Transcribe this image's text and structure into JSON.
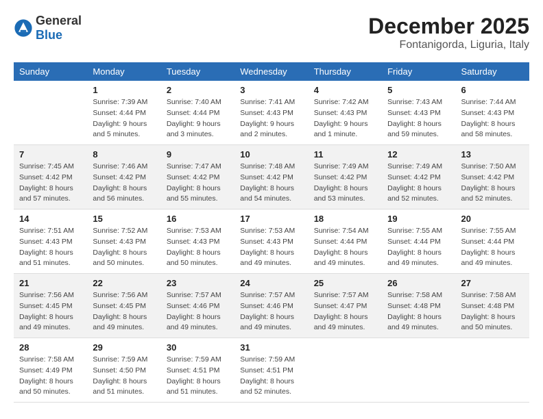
{
  "logo": {
    "general": "General",
    "blue": "Blue"
  },
  "title": "December 2025",
  "subtitle": "Fontanigorda, Liguria, Italy",
  "weekdays": [
    "Sunday",
    "Monday",
    "Tuesday",
    "Wednesday",
    "Thursday",
    "Friday",
    "Saturday"
  ],
  "weeks": [
    [
      {
        "day": "",
        "sunrise": "",
        "sunset": "",
        "daylight": ""
      },
      {
        "day": "1",
        "sunrise": "Sunrise: 7:39 AM",
        "sunset": "Sunset: 4:44 PM",
        "daylight": "Daylight: 9 hours and 5 minutes."
      },
      {
        "day": "2",
        "sunrise": "Sunrise: 7:40 AM",
        "sunset": "Sunset: 4:44 PM",
        "daylight": "Daylight: 9 hours and 3 minutes."
      },
      {
        "day": "3",
        "sunrise": "Sunrise: 7:41 AM",
        "sunset": "Sunset: 4:43 PM",
        "daylight": "Daylight: 9 hours and 2 minutes."
      },
      {
        "day": "4",
        "sunrise": "Sunrise: 7:42 AM",
        "sunset": "Sunset: 4:43 PM",
        "daylight": "Daylight: 9 hours and 1 minute."
      },
      {
        "day": "5",
        "sunrise": "Sunrise: 7:43 AM",
        "sunset": "Sunset: 4:43 PM",
        "daylight": "Daylight: 8 hours and 59 minutes."
      },
      {
        "day": "6",
        "sunrise": "Sunrise: 7:44 AM",
        "sunset": "Sunset: 4:43 PM",
        "daylight": "Daylight: 8 hours and 58 minutes."
      }
    ],
    [
      {
        "day": "7",
        "sunrise": "Sunrise: 7:45 AM",
        "sunset": "Sunset: 4:42 PM",
        "daylight": "Daylight: 8 hours and 57 minutes."
      },
      {
        "day": "8",
        "sunrise": "Sunrise: 7:46 AM",
        "sunset": "Sunset: 4:42 PM",
        "daylight": "Daylight: 8 hours and 56 minutes."
      },
      {
        "day": "9",
        "sunrise": "Sunrise: 7:47 AM",
        "sunset": "Sunset: 4:42 PM",
        "daylight": "Daylight: 8 hours and 55 minutes."
      },
      {
        "day": "10",
        "sunrise": "Sunrise: 7:48 AM",
        "sunset": "Sunset: 4:42 PM",
        "daylight": "Daylight: 8 hours and 54 minutes."
      },
      {
        "day": "11",
        "sunrise": "Sunrise: 7:49 AM",
        "sunset": "Sunset: 4:42 PM",
        "daylight": "Daylight: 8 hours and 53 minutes."
      },
      {
        "day": "12",
        "sunrise": "Sunrise: 7:49 AM",
        "sunset": "Sunset: 4:42 PM",
        "daylight": "Daylight: 8 hours and 52 minutes."
      },
      {
        "day": "13",
        "sunrise": "Sunrise: 7:50 AM",
        "sunset": "Sunset: 4:42 PM",
        "daylight": "Daylight: 8 hours and 52 minutes."
      }
    ],
    [
      {
        "day": "14",
        "sunrise": "Sunrise: 7:51 AM",
        "sunset": "Sunset: 4:43 PM",
        "daylight": "Daylight: 8 hours and 51 minutes."
      },
      {
        "day": "15",
        "sunrise": "Sunrise: 7:52 AM",
        "sunset": "Sunset: 4:43 PM",
        "daylight": "Daylight: 8 hours and 50 minutes."
      },
      {
        "day": "16",
        "sunrise": "Sunrise: 7:53 AM",
        "sunset": "Sunset: 4:43 PM",
        "daylight": "Daylight: 8 hours and 50 minutes."
      },
      {
        "day": "17",
        "sunrise": "Sunrise: 7:53 AM",
        "sunset": "Sunset: 4:43 PM",
        "daylight": "Daylight: 8 hours and 49 minutes."
      },
      {
        "day": "18",
        "sunrise": "Sunrise: 7:54 AM",
        "sunset": "Sunset: 4:44 PM",
        "daylight": "Daylight: 8 hours and 49 minutes."
      },
      {
        "day": "19",
        "sunrise": "Sunrise: 7:55 AM",
        "sunset": "Sunset: 4:44 PM",
        "daylight": "Daylight: 8 hours and 49 minutes."
      },
      {
        "day": "20",
        "sunrise": "Sunrise: 7:55 AM",
        "sunset": "Sunset: 4:44 PM",
        "daylight": "Daylight: 8 hours and 49 minutes."
      }
    ],
    [
      {
        "day": "21",
        "sunrise": "Sunrise: 7:56 AM",
        "sunset": "Sunset: 4:45 PM",
        "daylight": "Daylight: 8 hours and 49 minutes."
      },
      {
        "day": "22",
        "sunrise": "Sunrise: 7:56 AM",
        "sunset": "Sunset: 4:45 PM",
        "daylight": "Daylight: 8 hours and 49 minutes."
      },
      {
        "day": "23",
        "sunrise": "Sunrise: 7:57 AM",
        "sunset": "Sunset: 4:46 PM",
        "daylight": "Daylight: 8 hours and 49 minutes."
      },
      {
        "day": "24",
        "sunrise": "Sunrise: 7:57 AM",
        "sunset": "Sunset: 4:46 PM",
        "daylight": "Daylight: 8 hours and 49 minutes."
      },
      {
        "day": "25",
        "sunrise": "Sunrise: 7:57 AM",
        "sunset": "Sunset: 4:47 PM",
        "daylight": "Daylight: 8 hours and 49 minutes."
      },
      {
        "day": "26",
        "sunrise": "Sunrise: 7:58 AM",
        "sunset": "Sunset: 4:48 PM",
        "daylight": "Daylight: 8 hours and 49 minutes."
      },
      {
        "day": "27",
        "sunrise": "Sunrise: 7:58 AM",
        "sunset": "Sunset: 4:48 PM",
        "daylight": "Daylight: 8 hours and 50 minutes."
      }
    ],
    [
      {
        "day": "28",
        "sunrise": "Sunrise: 7:58 AM",
        "sunset": "Sunset: 4:49 PM",
        "daylight": "Daylight: 8 hours and 50 minutes."
      },
      {
        "day": "29",
        "sunrise": "Sunrise: 7:59 AM",
        "sunset": "Sunset: 4:50 PM",
        "daylight": "Daylight: 8 hours and 51 minutes."
      },
      {
        "day": "30",
        "sunrise": "Sunrise: 7:59 AM",
        "sunset": "Sunset: 4:51 PM",
        "daylight": "Daylight: 8 hours and 51 minutes."
      },
      {
        "day": "31",
        "sunrise": "Sunrise: 7:59 AM",
        "sunset": "Sunset: 4:51 PM",
        "daylight": "Daylight: 8 hours and 52 minutes."
      },
      {
        "day": "",
        "sunrise": "",
        "sunset": "",
        "daylight": ""
      },
      {
        "day": "",
        "sunrise": "",
        "sunset": "",
        "daylight": ""
      },
      {
        "day": "",
        "sunrise": "",
        "sunset": "",
        "daylight": ""
      }
    ]
  ]
}
